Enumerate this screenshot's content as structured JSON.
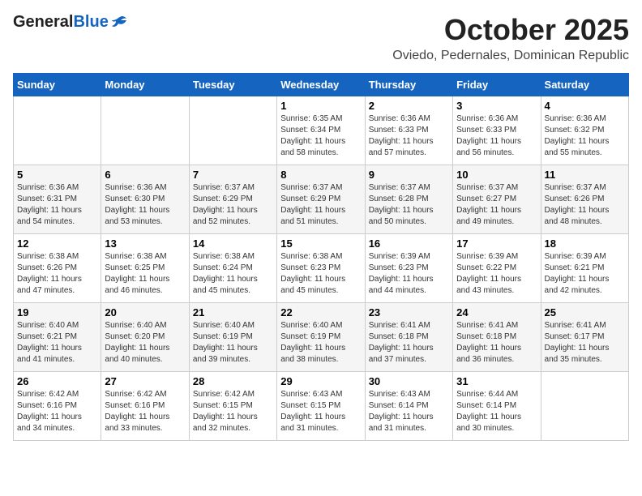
{
  "header": {
    "logo_general": "General",
    "logo_blue": "Blue",
    "title": "October 2025",
    "subtitle": "Oviedo, Pedernales, Dominican Republic"
  },
  "days_of_week": [
    "Sunday",
    "Monday",
    "Tuesday",
    "Wednesday",
    "Thursday",
    "Friday",
    "Saturday"
  ],
  "weeks": [
    [
      {
        "day": "",
        "info": ""
      },
      {
        "day": "",
        "info": ""
      },
      {
        "day": "",
        "info": ""
      },
      {
        "day": "1",
        "info": "Sunrise: 6:35 AM\nSunset: 6:34 PM\nDaylight: 11 hours\nand 58 minutes."
      },
      {
        "day": "2",
        "info": "Sunrise: 6:36 AM\nSunset: 6:33 PM\nDaylight: 11 hours\nand 57 minutes."
      },
      {
        "day": "3",
        "info": "Sunrise: 6:36 AM\nSunset: 6:33 PM\nDaylight: 11 hours\nand 56 minutes."
      },
      {
        "day": "4",
        "info": "Sunrise: 6:36 AM\nSunset: 6:32 PM\nDaylight: 11 hours\nand 55 minutes."
      }
    ],
    [
      {
        "day": "5",
        "info": "Sunrise: 6:36 AM\nSunset: 6:31 PM\nDaylight: 11 hours\nand 54 minutes."
      },
      {
        "day": "6",
        "info": "Sunrise: 6:36 AM\nSunset: 6:30 PM\nDaylight: 11 hours\nand 53 minutes."
      },
      {
        "day": "7",
        "info": "Sunrise: 6:37 AM\nSunset: 6:29 PM\nDaylight: 11 hours\nand 52 minutes."
      },
      {
        "day": "8",
        "info": "Sunrise: 6:37 AM\nSunset: 6:29 PM\nDaylight: 11 hours\nand 51 minutes."
      },
      {
        "day": "9",
        "info": "Sunrise: 6:37 AM\nSunset: 6:28 PM\nDaylight: 11 hours\nand 50 minutes."
      },
      {
        "day": "10",
        "info": "Sunrise: 6:37 AM\nSunset: 6:27 PM\nDaylight: 11 hours\nand 49 minutes."
      },
      {
        "day": "11",
        "info": "Sunrise: 6:37 AM\nSunset: 6:26 PM\nDaylight: 11 hours\nand 48 minutes."
      }
    ],
    [
      {
        "day": "12",
        "info": "Sunrise: 6:38 AM\nSunset: 6:26 PM\nDaylight: 11 hours\nand 47 minutes."
      },
      {
        "day": "13",
        "info": "Sunrise: 6:38 AM\nSunset: 6:25 PM\nDaylight: 11 hours\nand 46 minutes."
      },
      {
        "day": "14",
        "info": "Sunrise: 6:38 AM\nSunset: 6:24 PM\nDaylight: 11 hours\nand 45 minutes."
      },
      {
        "day": "15",
        "info": "Sunrise: 6:38 AM\nSunset: 6:23 PM\nDaylight: 11 hours\nand 45 minutes."
      },
      {
        "day": "16",
        "info": "Sunrise: 6:39 AM\nSunset: 6:23 PM\nDaylight: 11 hours\nand 44 minutes."
      },
      {
        "day": "17",
        "info": "Sunrise: 6:39 AM\nSunset: 6:22 PM\nDaylight: 11 hours\nand 43 minutes."
      },
      {
        "day": "18",
        "info": "Sunrise: 6:39 AM\nSunset: 6:21 PM\nDaylight: 11 hours\nand 42 minutes."
      }
    ],
    [
      {
        "day": "19",
        "info": "Sunrise: 6:40 AM\nSunset: 6:21 PM\nDaylight: 11 hours\nand 41 minutes."
      },
      {
        "day": "20",
        "info": "Sunrise: 6:40 AM\nSunset: 6:20 PM\nDaylight: 11 hours\nand 40 minutes."
      },
      {
        "day": "21",
        "info": "Sunrise: 6:40 AM\nSunset: 6:19 PM\nDaylight: 11 hours\nand 39 minutes."
      },
      {
        "day": "22",
        "info": "Sunrise: 6:40 AM\nSunset: 6:19 PM\nDaylight: 11 hours\nand 38 minutes."
      },
      {
        "day": "23",
        "info": "Sunrise: 6:41 AM\nSunset: 6:18 PM\nDaylight: 11 hours\nand 37 minutes."
      },
      {
        "day": "24",
        "info": "Sunrise: 6:41 AM\nSunset: 6:18 PM\nDaylight: 11 hours\nand 36 minutes."
      },
      {
        "day": "25",
        "info": "Sunrise: 6:41 AM\nSunset: 6:17 PM\nDaylight: 11 hours\nand 35 minutes."
      }
    ],
    [
      {
        "day": "26",
        "info": "Sunrise: 6:42 AM\nSunset: 6:16 PM\nDaylight: 11 hours\nand 34 minutes."
      },
      {
        "day": "27",
        "info": "Sunrise: 6:42 AM\nSunset: 6:16 PM\nDaylight: 11 hours\nand 33 minutes."
      },
      {
        "day": "28",
        "info": "Sunrise: 6:42 AM\nSunset: 6:15 PM\nDaylight: 11 hours\nand 32 minutes."
      },
      {
        "day": "29",
        "info": "Sunrise: 6:43 AM\nSunset: 6:15 PM\nDaylight: 11 hours\nand 31 minutes."
      },
      {
        "day": "30",
        "info": "Sunrise: 6:43 AM\nSunset: 6:14 PM\nDaylight: 11 hours\nand 31 minutes."
      },
      {
        "day": "31",
        "info": "Sunrise: 6:44 AM\nSunset: 6:14 PM\nDaylight: 11 hours\nand 30 minutes."
      },
      {
        "day": "",
        "info": ""
      }
    ]
  ]
}
